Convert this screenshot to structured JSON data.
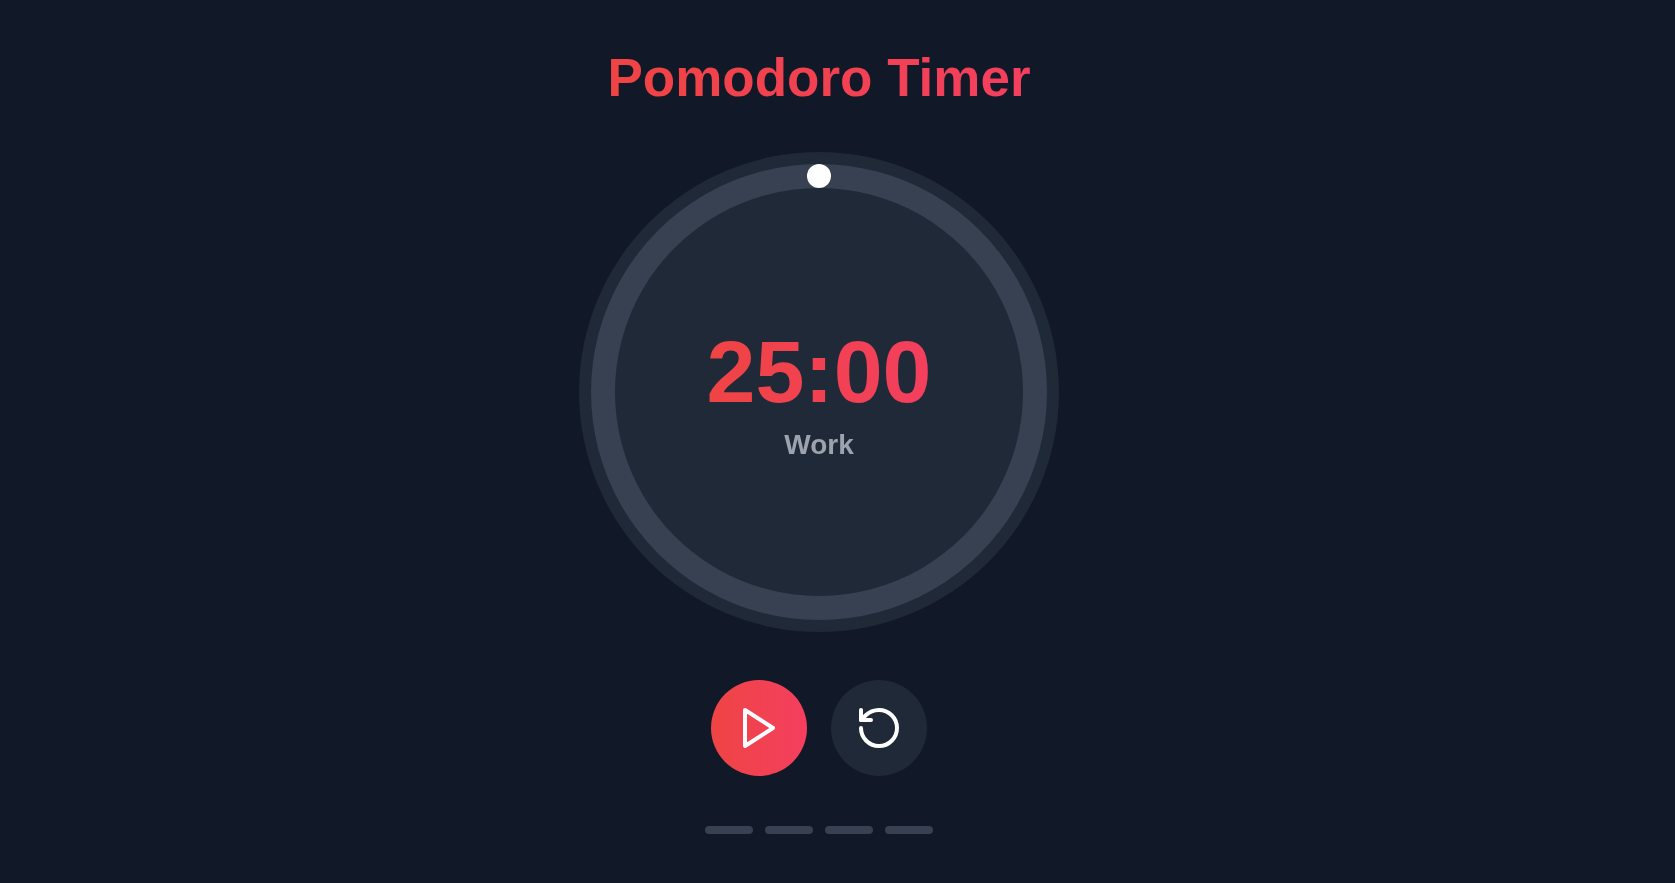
{
  "title": "Pomodoro Timer",
  "timer": {
    "time": "25:00",
    "mode": "Work"
  },
  "controls": [
    {
      "kind": "play"
    },
    {
      "kind": "reset"
    }
  ],
  "sessions": [
    {
      "done": false
    },
    {
      "done": false
    },
    {
      "done": false
    },
    {
      "done": false
    }
  ]
}
